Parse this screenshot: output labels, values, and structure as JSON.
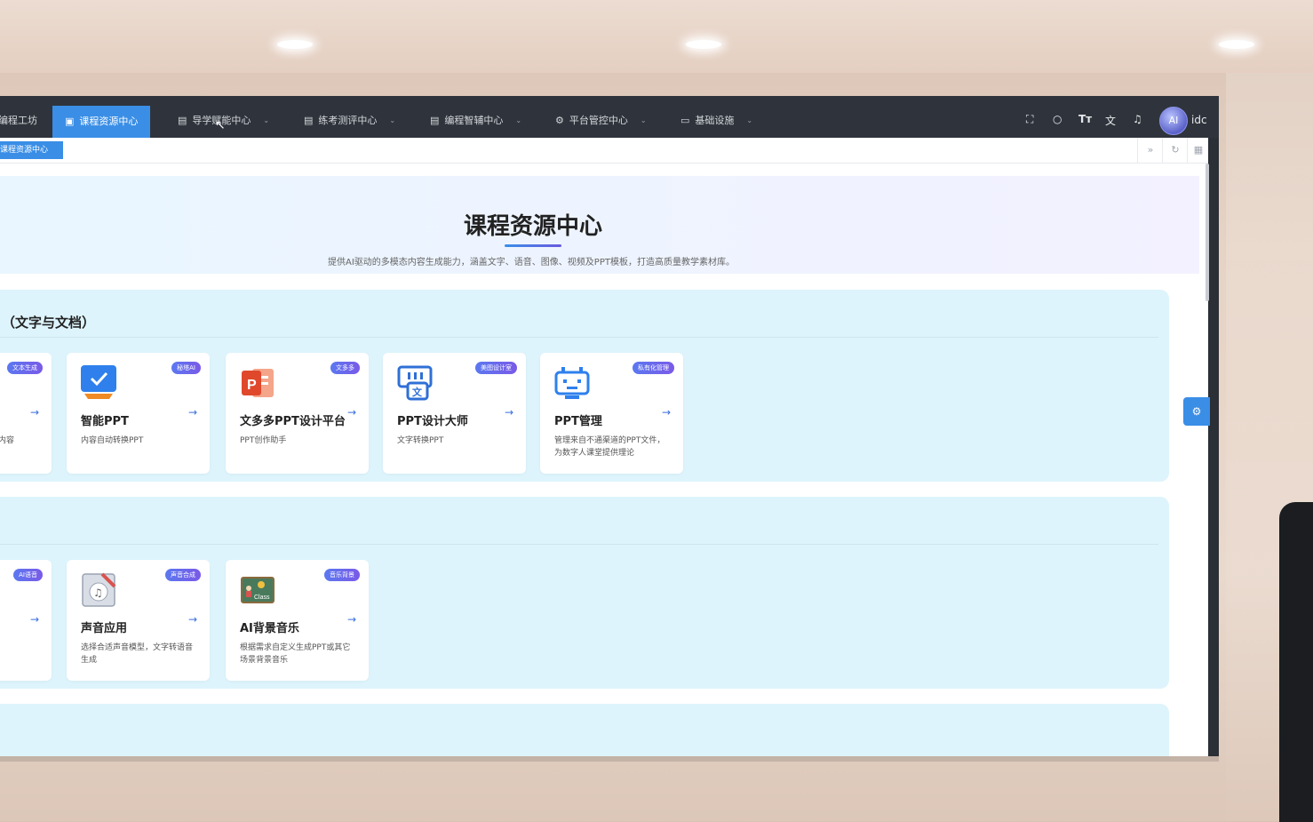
{
  "nav": {
    "items": [
      {
        "label": "编程工坊",
        "icon": "book-icon"
      },
      {
        "label": "课程资源中心",
        "icon": "image-icon"
      },
      {
        "label": "导学赋能中心",
        "icon": "book-icon"
      },
      {
        "label": "练考测评中心",
        "icon": "book-icon"
      },
      {
        "label": "编程智辅中心",
        "icon": "book-icon"
      },
      {
        "label": "平台管控中心",
        "icon": "gear-icon"
      },
      {
        "label": "基础设施",
        "icon": "monitor-icon"
      }
    ],
    "active_index": 1,
    "user": {
      "avatar_text": "AI",
      "name": "idc"
    }
  },
  "tabs": {
    "active": "课程资源中心"
  },
  "hero": {
    "title": "课程资源中心",
    "description": "提供AI驱动的多模态内容生成能力，涵盖文字、语音、图像、视频及PPT模板，打造高质量教学素材库。"
  },
  "sections": [
    {
      "title": "（文字与文档）",
      "cards": [
        {
          "name": "",
          "badge": "文本生成",
          "desc": "内容"
        },
        {
          "name": "智能PPT",
          "badge": "秘塔AI",
          "desc": "内容自动转换PPT",
          "icon": "presentation-check-icon"
        },
        {
          "name": "文多多PPT设计平台",
          "badge": "文多多",
          "desc": "PPT创作助手",
          "icon": "powerpoint-icon"
        },
        {
          "name": "PPT设计大师",
          "badge": "美图设计室",
          "desc": "文字转换PPT",
          "icon": "slide-text-icon"
        },
        {
          "name": "PPT管理",
          "badge": "私有化管理",
          "desc": "管理来自不通渠道的PPT文件，为数字人课堂提供理论",
          "icon": "robot-icon"
        }
      ]
    },
    {
      "title": "",
      "cards": [
        {
          "name": "",
          "badge": "AI语音",
          "desc": ""
        },
        {
          "name": "声音应用",
          "badge": "声音合成",
          "desc": "选择合适声音模型，文字转语音生成",
          "icon": "music-file-icon"
        },
        {
          "name": "AI背景音乐",
          "badge": "音乐背景",
          "desc": "根据需求自定义生成PPT或其它场景背景音乐",
          "icon": "classroom-board-icon"
        }
      ]
    }
  ],
  "colors": {
    "accent": "#3a8ee6",
    "nav_bg": "#2f343c",
    "section_bg": "#def4fc"
  }
}
